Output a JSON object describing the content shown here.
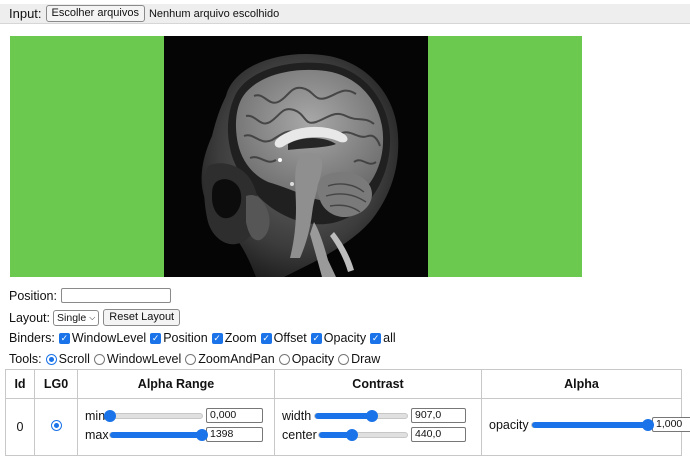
{
  "input": {
    "label": "Input:",
    "choose_button": "Escolher arquivos",
    "no_file": "Nenhum arquivo escolhido"
  },
  "viewer": {
    "background_color": "#6cc94f",
    "image_subject": "sagittal brain MRI"
  },
  "position": {
    "label": "Position:",
    "value": ""
  },
  "layout": {
    "label": "Layout:",
    "selected": "Single",
    "reset_button": "Reset Layout"
  },
  "binders": {
    "label": "Binders:",
    "items": [
      {
        "label": "WindowLevel",
        "checked": true
      },
      {
        "label": "Position",
        "checked": true
      },
      {
        "label": "Zoom",
        "checked": true
      },
      {
        "label": "Offset",
        "checked": true
      },
      {
        "label": "Opacity",
        "checked": true
      },
      {
        "label": "all",
        "checked": true
      }
    ]
  },
  "tools": {
    "label": "Tools:",
    "items": [
      {
        "label": "Scroll",
        "selected": true
      },
      {
        "label": "WindowLevel",
        "selected": false
      },
      {
        "label": "ZoomAndPan",
        "selected": false
      },
      {
        "label": "Opacity",
        "selected": false
      },
      {
        "label": "Draw",
        "selected": false
      }
    ]
  },
  "table": {
    "headers": [
      "Id",
      "LG0",
      "Alpha Range",
      "Contrast",
      "Alpha"
    ],
    "row": {
      "id": "0",
      "alpha_range": {
        "min_label": "min",
        "min_value": "0,000",
        "min_fraction": 0.0,
        "max_label": "max",
        "max_value": "1398",
        "max_fraction": 1.0
      },
      "contrast": {
        "width_label": "width",
        "width_value": "907,0",
        "width_fraction": 0.62,
        "center_label": "center",
        "center_value": "440,0",
        "center_fraction": 0.38
      },
      "alpha": {
        "opacity_label": "opacity",
        "opacity_value": "1,000",
        "opacity_fraction": 1.0
      }
    }
  }
}
